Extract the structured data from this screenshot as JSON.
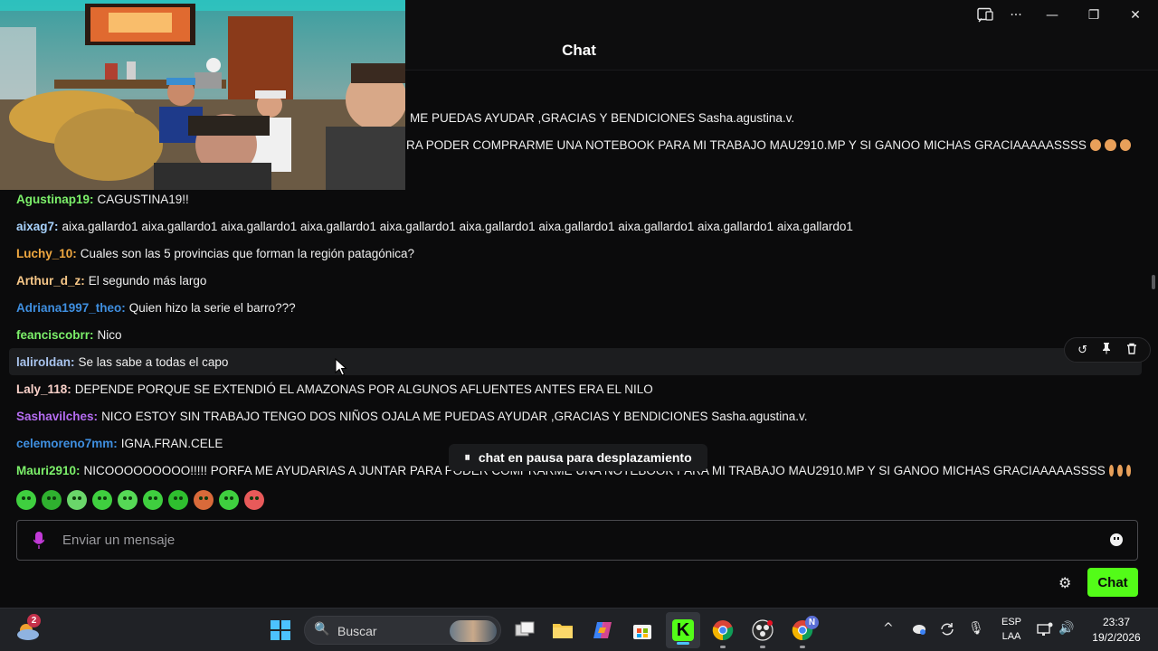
{
  "window": {
    "header_title": "Chat",
    "controls": [
      "cast-icon",
      "more-icon",
      "minimize-icon",
      "restore-icon",
      "close-icon"
    ],
    "more_glyph": "···",
    "min_glyph": "—",
    "restore_glyph": "❐",
    "close_glyph": "✕"
  },
  "partial_lines": [
    {
      "text": "ME PUEDAS AYUDAR ,GRACIAS Y BENDICIONES Sasha.agustina.v."
    },
    {
      "text": "RA PODER COMPRARME UNA NOTEBOOK PARA MI TRABAJO MAU2910.MP Y SI GANOO MICHAS GRACIAAAAASSSS"
    }
  ],
  "messages": [
    {
      "user": "Agustinap19:",
      "color": "#7cf06a",
      "text": "CAGUSTINA19!!",
      "emotes": 0
    },
    {
      "user": "aixag7:",
      "color": "#a9d4ff",
      "text": "aixa.gallardo1 aixa.gallardo1 aixa.gallardo1 aixa.gallardo1 aixa.gallardo1 aixa.gallardo1 aixa.gallardo1 aixa.gallardo1 aixa.gallardo1 aixa.gallardo1",
      "emotes": 0
    },
    {
      "user": "Luchy_10:",
      "color": "#f0a840",
      "text": "Cuales son las 5 provincias que forman la región patagónica?",
      "emotes": 0
    },
    {
      "user": "Arthur_d_z:",
      "color": "#f8c889",
      "text": "El segundo más largo",
      "emotes": 0
    },
    {
      "user": "Adriana1997_theo:",
      "color": "#3f8fe0",
      "text": "Quien hizo la serie el barro???",
      "emotes": 0
    },
    {
      "user": "feanciscobrr:",
      "color": "#7cf06a",
      "text": "Nico",
      "emotes": 0
    },
    {
      "user": "laliroldan:",
      "color": "#a9c4ee",
      "text": "Se las sabe a todas el capo",
      "emotes": 0
    },
    {
      "user": "Laly_118:",
      "color": "#f8d0c8",
      "text": "DEPENDE PORQUE SE EXTENDIÓ EL AMAZONAS POR ALGUNOS AFLUENTES ANTES ERA EL NILO",
      "emotes": 0
    },
    {
      "user": "Sashavilches:",
      "color": "#b46cf0",
      "text": "NICO ESTOY SIN TRABAJO TENGO DOS NIÑOS OJALA ME PUEDAS AYUDAR ,GRACIAS Y BENDICIONES Sasha.agustina.v.",
      "emotes": 0
    },
    {
      "user": "celemoreno7mm:",
      "color": "#3f8fe0",
      "text": "IGNA.FRAN.CELE",
      "emotes": 0
    },
    {
      "user": "Mauri2910:",
      "color": "#7cf06a",
      "text": "NICOOOOOOOOO!!!!! PORFA ME AYUDARIAS A JUNTAR PARA PODER COMPRARME UNA NOTEBOOK PARA MI TRABAJO MAU2910.MP Y SI GANOO MICHAS GRACIAAAAASSSS",
      "emotes": 3
    }
  ],
  "message_actions": {
    "reply": "↺",
    "pin": "📌",
    "delete": "🗑"
  },
  "pause_notice": {
    "icon": "⏸",
    "text": "chat en pausa para desplazamiento"
  },
  "emote_bar_count": 10,
  "input": {
    "placeholder": "Enviar un mensaje",
    "value": ""
  },
  "send_button": "Chat",
  "settings_glyph": "⚙",
  "accent_color": "#53fc18",
  "taskbar": {
    "weather_badge": "2",
    "search_label": "Buscar",
    "search_glyph": "🔍",
    "chrome_badge": "N",
    "lang_line1": "ESP",
    "lang_line2": "LAA",
    "time": "23:37",
    "date": "19/2/2026",
    "tray_up": "^",
    "tray_mic": "🎙",
    "tray_speaker": "🔊"
  }
}
